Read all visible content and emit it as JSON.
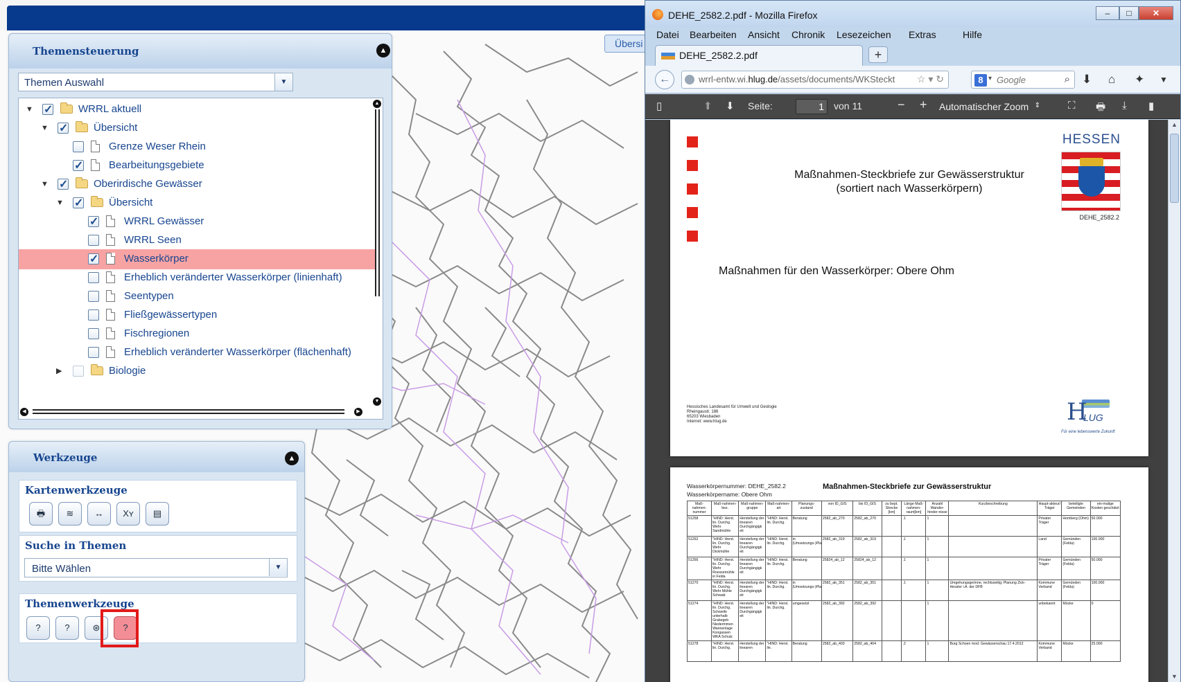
{
  "map_app": {
    "uebersicht_tab": "Übersi",
    "themen_panel": {
      "title": "Themensteuerung",
      "collapse_icon": "chevron-up-icon",
      "select_value": "Themen Auswahl",
      "tree": [
        {
          "label": "WRRL aktuell",
          "level": 0,
          "expander": "▼",
          "checked": true,
          "icon": "folder",
          "selected": false
        },
        {
          "label": "Übersicht",
          "level": 1,
          "expander": "▼",
          "checked": true,
          "icon": "folder",
          "selected": false
        },
        {
          "label": "Grenze Weser Rhein",
          "level": 2,
          "expander": "",
          "checked": false,
          "icon": "file",
          "selected": false
        },
        {
          "label": "Bearbeitungsgebiete",
          "level": 2,
          "expander": "",
          "checked": true,
          "icon": "file",
          "selected": false
        },
        {
          "label": "Oberirdische Gewässer",
          "level": 1,
          "expander": "▼",
          "checked": true,
          "icon": "folder",
          "selected": false
        },
        {
          "label": "Übersicht",
          "level": 2,
          "expander": "▼",
          "checked": true,
          "icon": "folder",
          "selected": false
        },
        {
          "label": "WRRL Gewässer",
          "level": 3,
          "expander": "",
          "checked": true,
          "icon": "file",
          "selected": false
        },
        {
          "label": "WRRL Seen",
          "level": 3,
          "expander": "",
          "checked": false,
          "icon": "file",
          "selected": false
        },
        {
          "label": "Wasserkörper",
          "level": 3,
          "expander": "",
          "checked": true,
          "icon": "file",
          "selected": true
        },
        {
          "label": "Erheblich veränderter Wasserkörper (linienhaft)",
          "level": 3,
          "expander": "",
          "checked": false,
          "icon": "file",
          "selected": false
        },
        {
          "label": "Seentypen",
          "level": 3,
          "expander": "",
          "checked": false,
          "icon": "file",
          "selected": false
        },
        {
          "label": "Fließgewässertypen",
          "level": 3,
          "expander": "",
          "checked": false,
          "icon": "file",
          "selected": false
        },
        {
          "label": "Fischregionen",
          "level": 3,
          "expander": "",
          "checked": false,
          "icon": "file",
          "selected": false
        },
        {
          "label": "Erheblich veränderter Wasserkörper (flächenhaft)",
          "level": 3,
          "expander": "",
          "checked": false,
          "icon": "file",
          "selected": false
        },
        {
          "label": "Biologie",
          "level": 2,
          "expander": "▶",
          "checked": false,
          "icon": "folder",
          "selected": false,
          "faded": true
        }
      ]
    },
    "werkzeuge_panel": {
      "title": "Werkzeuge",
      "collapse_icon": "chevron-up-icon",
      "kartenwerkzeuge": {
        "title": "Kartenwerkzeuge",
        "tools": [
          {
            "icon": "print-icon",
            "glyph": "🖶"
          },
          {
            "icon": "layers-icon",
            "glyph": "≋"
          },
          {
            "icon": "measure-icon",
            "glyph": "↔"
          },
          {
            "icon": "coordinates-icon",
            "glyph": "Xʏ"
          },
          {
            "icon": "document-icon",
            "glyph": "▤"
          }
        ]
      },
      "suche": {
        "title": "Suche in Themen",
        "select_value": "Bitte Wählen"
      },
      "themenwerkzeuge": {
        "title": "Themenwerkzeuge",
        "tools": [
          {
            "icon": "info-icon",
            "glyph": "?",
            "active": false
          },
          {
            "icon": "info-list-icon",
            "glyph": "?",
            "active": false
          },
          {
            "icon": "info-search-icon",
            "glyph": "⊛",
            "active": false
          },
          {
            "icon": "info-multi-icon",
            "glyph": "?",
            "active": true
          }
        ]
      }
    }
  },
  "firefox": {
    "title": "DEHE_2582.2.pdf - Mozilla Firefox",
    "menu": [
      "Datei",
      "Bearbeiten",
      "Ansicht",
      "Chronik",
      "Lesezeichen",
      "Extras",
      "Hilfe"
    ],
    "tab_label": "DEHE_2582.2.pdf",
    "url_prefix": "wrrl-entw.wi.",
    "url_domain": "hlug.de",
    "url_path": "/assets/documents/WKSteckt",
    "search_engine_badge": "8",
    "search_placeholder": "Google",
    "pdf_toolbar": {
      "page_label": "Seite:",
      "page_value": "1",
      "page_total": "von 11",
      "zoom": "Automatischer Zoom"
    },
    "page1": {
      "state": "HESSEN",
      "title_line1": "Maßnahmen-Steckbriefe zur Gewässerstruktur",
      "title_line2": "(sortiert nach Wasserkörpern)",
      "code": "DEHE_2582.2",
      "subtitle": "Maßnahmen für den Wasserkörper:  Obere Ohm",
      "footer": [
        "Hessisches Landesamt für Umwelt und Geologie",
        "Rheingaustr. 186",
        "65203 Wiesbaden",
        "Internet: www.hlug.de"
      ],
      "logo_text": "LUG",
      "logo_letter": "H",
      "tagline": "Für eine lebenswerte Zukunft"
    },
    "page2": {
      "meta1": "Wasserkörpernummer: DEHE_2582.2",
      "meta2": "Wasserkörpername: Obere Ohm",
      "title": "Maßnahmen-Steckbriefe zur Gewässerstruktur",
      "headers": [
        "Maß-nahmen-nummer",
        "Maß-nahmen-bez.",
        "Maß-nahmen-gruppe",
        "Maß-nahmen-art",
        "Planungs-zustand",
        "von ID_GIS",
        "bis ID_GIS",
        "zu bept. Strecke [km]",
        "Länge Maß-nahmen-raum[km]",
        "Anzahl Wander-hinder-nisse",
        "Kurzbeschreibung",
        "Haupt-akteur/ Träger",
        "beteiligte Gemeinden",
        "ein-malige Kosten geschätzt"
      ],
      "rows": [
        [
          "51258",
          "\"HIND: Herst. lin. Durchg. Wehr Sandmühle",
          "Herstellung der linearen Durchgängigk eit",
          "\"HIND: Herst. lin. Durchg.",
          "Beratung",
          "2582_ab_270",
          "2582_ab_270",
          "",
          ".1",
          "1",
          "",
          "Privater Träger",
          "Homberg (Ohm)",
          "50.000"
        ],
        [
          "51262",
          "\"HIND: Herst. lin. Durchg. Wehr Dickmühle",
          "Herstellung der linearen Durchgängigk eit",
          "\"HIND: Herst. lin. Durchg.",
          "in (Umsetzungs-)Planung",
          "2582_ab_319",
          "2582_ab_319",
          "",
          ".1",
          "1",
          "",
          "Land",
          "Gemünden (Felda)",
          "100.000"
        ],
        [
          "51266",
          "\"HIND: Herst. lin. Durchg. Wehr Roessemühle in Felda",
          "Herstellung der linearen Durchgängigk eit",
          "\"HIND: Herst. lin. Durchg.",
          "Beratung",
          "25824_ab_12",
          "25824_ab_12",
          "",
          ".1",
          "1",
          "",
          "Privater Träger",
          "Gemünden (Felda)",
          "50.000"
        ],
        [
          "51270",
          "\"HIND: Herst. lin. Durchg. Wehr Mühle Schwab",
          "Herstellung der linearen Durchgängigk eit",
          "\"HIND: Herst. lin. Durchg.",
          "in (Umsetzungs-)Planung",
          "2582_ab_351",
          "2582_ab_351",
          "",
          ".1",
          "1",
          "Umgehungsgerinne, rechtsseitig; Planung Zick-Hessler i.A. der DFB",
          "Kommune Verband",
          "Gemünden (Felda)",
          "100.000"
        ],
        [
          "51274",
          "\"HIND: Herst. lin. Durchg. Schwelle unterhalb Grabegeb Niedermmen Wannenlage Kongassen WKA Schutz",
          "Herstellung der linearen Durchgängigk eit",
          "\"HIND: Herst. lin. Durchg.",
          "umgesetzt",
          "2582_ab_392",
          "2582_ab_392",
          "",
          "",
          "1",
          "",
          "unbekannt",
          "Mücke",
          "0"
        ],
        [
          "51278",
          "\"HIND: Herst. lin. Durchg.",
          "Herstellung der linearen",
          "\"HIND: Herst. lin.",
          "Beratung",
          "2582_ab_403",
          "2582_ab_404",
          "",
          ".2",
          "1",
          "Burg Schoen mod. Gewässerschau 17.4.2012",
          "Kommune Verband",
          "Mücke",
          "25.000"
        ]
      ]
    }
  },
  "colors": {
    "banner": "#073a8c",
    "selection": "#f8a3a3",
    "highlight": "#e21a1a",
    "panel_title": "#17458f",
    "pdf_toolbar": "#474747"
  }
}
